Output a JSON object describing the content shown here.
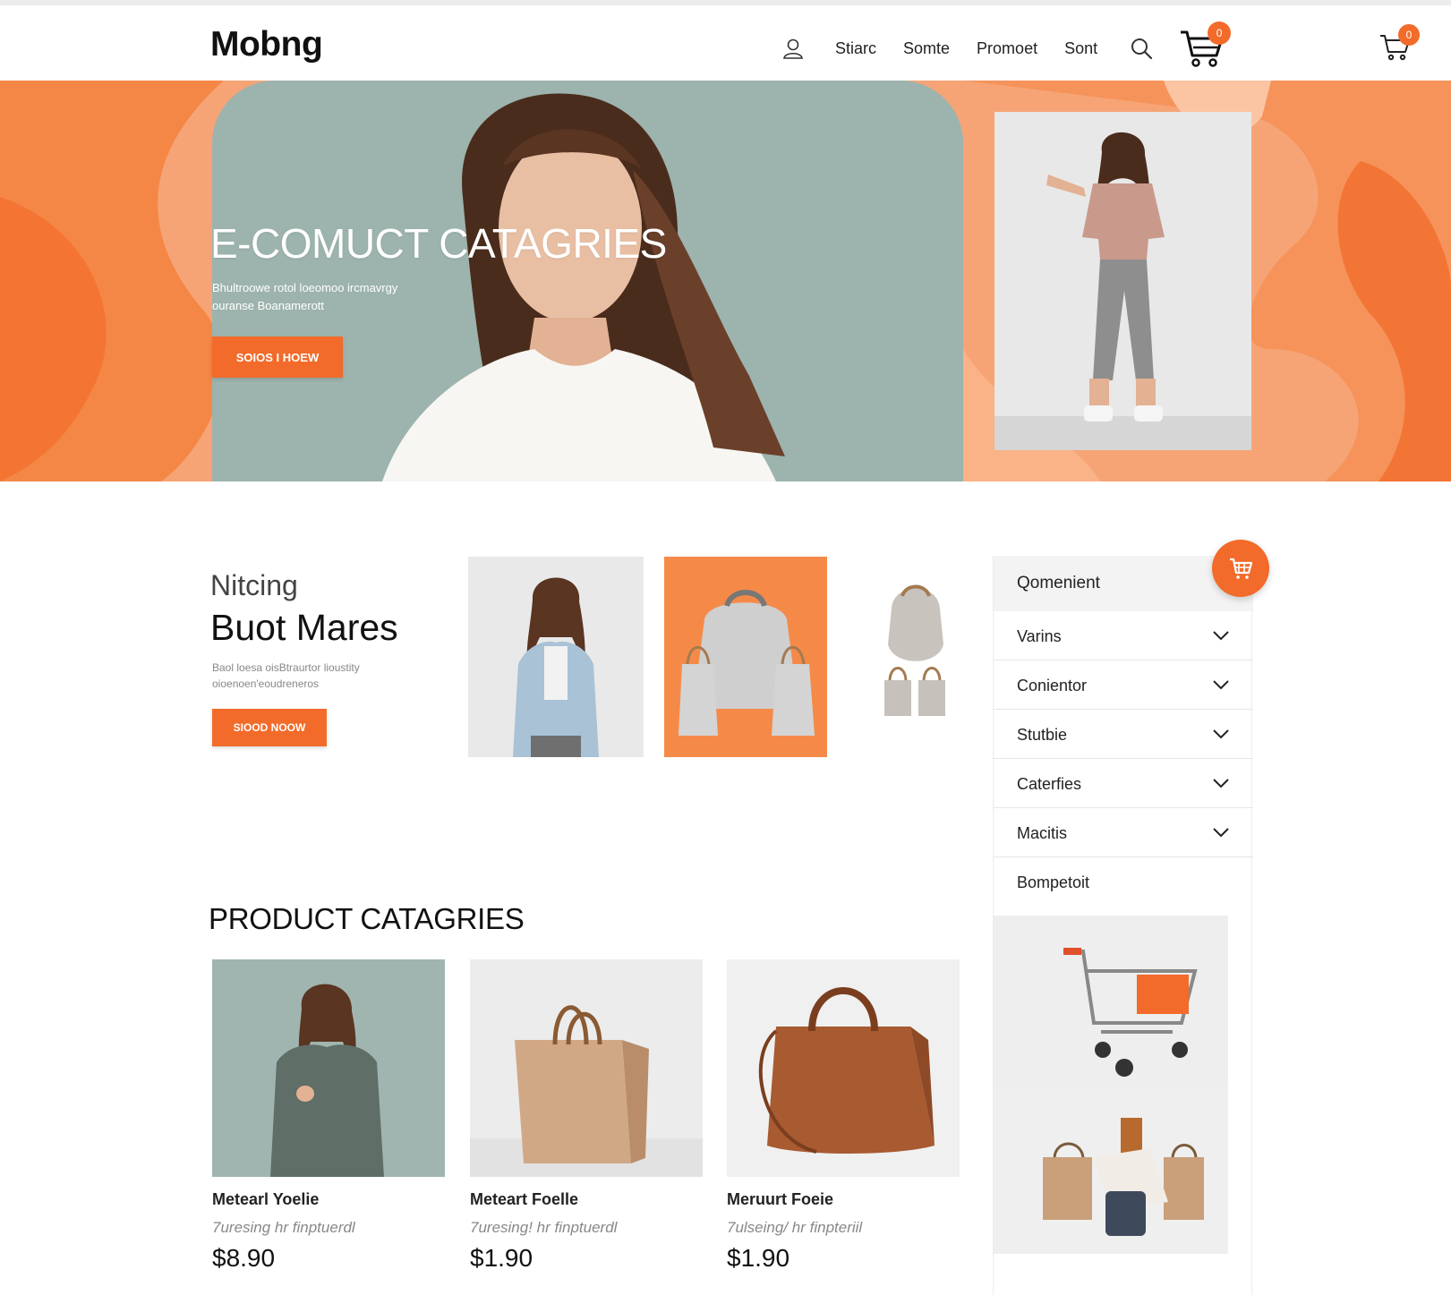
{
  "header": {
    "logo": "Mobng",
    "nav": [
      "Stiarc",
      "Somte",
      "Promoet",
      "Sont"
    ],
    "cart_badge": "0",
    "cart_small_badge": "0"
  },
  "hero": {
    "title": "E-COMUCT CATAGRIES",
    "subtitle": "Bhultroowe rotol loeomoo ircmavrgy ouranse Boanamerott",
    "button": "SOIOS I HOEW"
  },
  "featured": {
    "kicker": "Nitcing",
    "title": "Buot Mares",
    "description": "Baol loesa oisBtraurtor lioustity oioenoen'eoudreneros",
    "button": "SIOOD NOOW"
  },
  "filter_panel": {
    "header": "Qomenient",
    "items": [
      {
        "label": "Varins"
      },
      {
        "label": "Conientor"
      },
      {
        "label": "Stutbie"
      },
      {
        "label": "Caterfies"
      },
      {
        "label": "Macitis"
      },
      {
        "label": "Bompetoit"
      }
    ]
  },
  "categories": {
    "title": "PRODUCT CATAGRIES",
    "products": [
      {
        "name": "Metearl Yoelie",
        "desc": "7uresing hr finptuerdl",
        "price": "$8.90"
      },
      {
        "name": "Meteart Foelle",
        "desc": "7uresing! hr finptuerdl",
        "price": "$1.90"
      },
      {
        "name": "Meruurt Foeie",
        "desc": "7ulseing/ hr finpteriil",
        "price": "$1.90"
      }
    ]
  },
  "colors": {
    "accent": "#f26b2a",
    "hero_bg": "#f6a476",
    "hero_photo_bg": "#9db3ad"
  },
  "icons": [
    "user-icon",
    "search-icon",
    "cart-icon",
    "chevron-down-icon",
    "cart-fab-icon"
  ]
}
